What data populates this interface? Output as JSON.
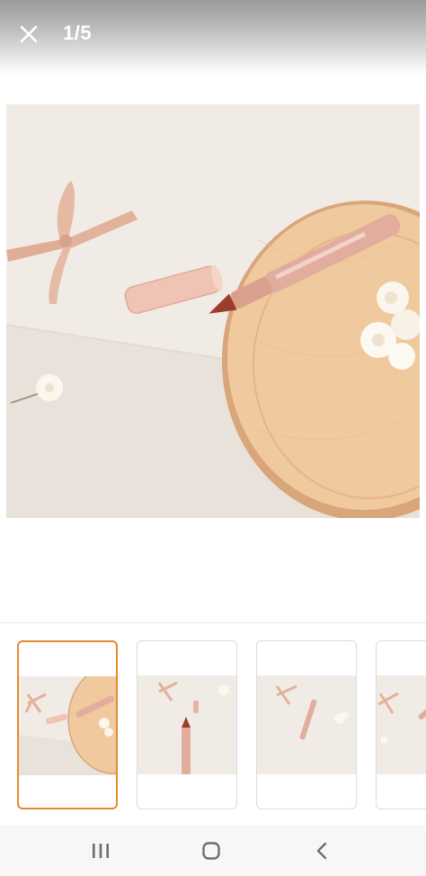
{
  "header": {
    "close_icon": "close-icon",
    "counter": "1/5"
  },
  "gallery": {
    "current_index": 1,
    "total": 5,
    "thumbnails": [
      {
        "name": "thumbnail-1",
        "selected": true
      },
      {
        "name": "thumbnail-2",
        "selected": false
      },
      {
        "name": "thumbnail-3",
        "selected": false
      },
      {
        "name": "thumbnail-4",
        "selected": false
      }
    ]
  },
  "navbar": {
    "recents_icon": "recents-icon",
    "home_icon": "home-icon",
    "back_icon": "back-icon"
  },
  "colors": {
    "selected_border": "#e58a2e",
    "background": "#ffffff"
  }
}
